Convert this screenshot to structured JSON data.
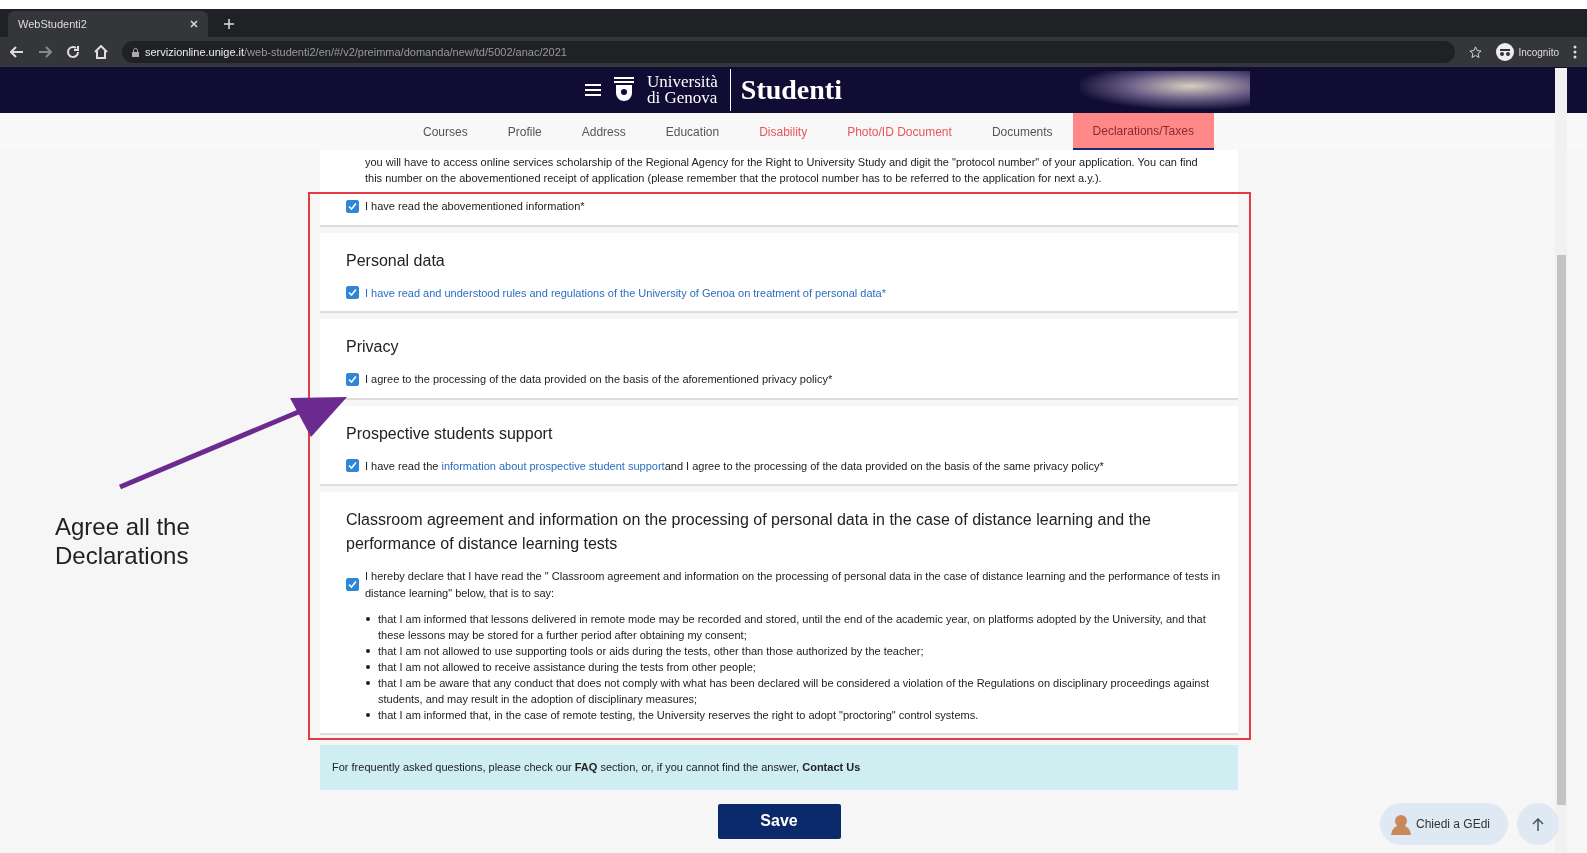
{
  "browser": {
    "tab_title": "WebStudenti2",
    "url_host": "servizionline.unige.it",
    "url_path": "/web-studenti2/en/#/v2/preimma/domanda/new/td/5002/anac/2021",
    "profile": "Incognito"
  },
  "header": {
    "logo_line1": "Università",
    "logo_line2": "di Genova",
    "app_title": "Studenti"
  },
  "tabs": [
    {
      "label": "Courses",
      "selected": false,
      "warning": false
    },
    {
      "label": "Profile",
      "selected": false,
      "warning": false
    },
    {
      "label": "Address",
      "selected": false,
      "warning": false
    },
    {
      "label": "Education",
      "selected": false,
      "warning": false
    },
    {
      "label": "Disability",
      "selected": false,
      "warning": true
    },
    {
      "label": "Photo/ID Document",
      "selected": false,
      "warning": true
    },
    {
      "label": "Documents",
      "selected": false,
      "warning": false
    },
    {
      "label": "Declarations/Taxes",
      "selected": true,
      "warning": true
    }
  ],
  "intro_text": "you will have to access online services scholarship of the Regional Agency for the Right to University Study and digit the \"protocol number\" of your application. You can find this number on the abovementioned receipt of application (please remember that the protocol number has to be referred to the application for next a.y.).",
  "sections": [
    {
      "checkbox": {
        "checked": true,
        "parts": [
          {
            "kind": "plain",
            "text": "I have read the abovementioned information*"
          }
        ]
      }
    },
    {
      "title": "Personal data",
      "checkbox": {
        "checked": true,
        "parts": [
          {
            "kind": "link",
            "text": "I have read and understood rules and regulations of the University of Genoa on treatment of personal data*"
          }
        ]
      }
    },
    {
      "title": "Privacy",
      "checkbox": {
        "checked": true,
        "parts": [
          {
            "kind": "plain",
            "text": "I agree to the processing of the data provided on the basis of the aforementioned privacy policy*"
          }
        ]
      }
    },
    {
      "title": "Prospective students support",
      "checkbox": {
        "checked": true,
        "parts": [
          {
            "kind": "plain",
            "text": "I have read the "
          },
          {
            "kind": "link",
            "text": "information about prospective student support"
          },
          {
            "kind": "plain",
            "text": "and I agree to the processing of the data provided on the basis of the same privacy policy*"
          }
        ]
      }
    },
    {
      "title": "Classroom agreement and information on the processing of personal data in the case of distance learning and the performance of distance learning tests",
      "checkbox": {
        "checked": true,
        "parts": [
          {
            "kind": "plain",
            "text": "I hereby declare that I have read the \" Classroom agreement and information on the processing of personal data in the case of distance learning and the performance of tests in distance learning\" below, that is to say:"
          }
        ]
      },
      "bullets": [
        "that I am informed that lessons delivered in remote mode may be recorded and stored, until the end of the academic year, on platforms adopted by the University, and that these lessons may be stored for a further period after obtaining my consent;",
        "that I am not allowed to use supporting tools or aids during the tests, other than those authorized by the teacher;",
        "that I am not allowed to receive assistance during the tests from other people;",
        "that I am be aware that any conduct that does not comply with what has been declared will be considered a violation of the Regulations on disciplinary proceedings against students, and may result in the adoption of disciplinary measures;",
        "that I am informed that, in the case of remote testing, the University reserves the right to adopt \"proctoring\" control systems."
      ]
    }
  ],
  "annotation": {
    "text": "Agree all the Declarations"
  },
  "help_text": "For frequently asked questions, please check our **FAQ** section, or, if you cannot find the answer, **Contact Us**",
  "save_button": "Save",
  "chat_button": "Chiedi a GEdi"
}
